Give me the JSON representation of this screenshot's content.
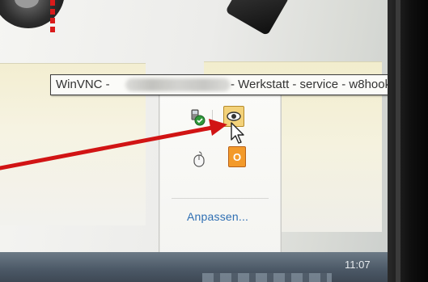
{
  "tooltip": {
    "app_prefix": "WinVNC - ",
    "rest": "- Werkstatt - service - w8hook"
  },
  "flyout": {
    "customize_label": "Anpassen...",
    "icons": {
      "usb": "usb-safely-remove-icon",
      "vnc": "winvnc-eye-icon",
      "mouse": "mouse-icon",
      "office": "office-icon"
    },
    "office_glyph": "O"
  },
  "taskbar": {
    "time": "11:07"
  },
  "annotation": {
    "arrow_color": "#d11414"
  },
  "colors": {
    "link": "#2f6fb3",
    "vnc_icon_bg": "#f3d27a",
    "office_icon_bg": "#f39a2a"
  }
}
